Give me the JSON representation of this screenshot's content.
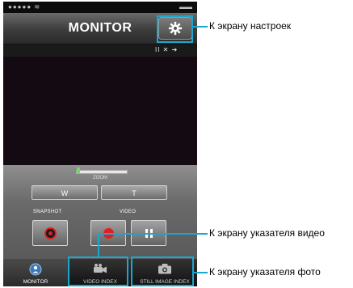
{
  "screen": {
    "title": "MONITOR",
    "statusbar": {
      "left": "●●●●●  ≋",
      "right": "▬▬"
    },
    "indicators": "II ✕ ➔",
    "zoom": {
      "label": "ZOOM",
      "level": 0.05,
      "wide_label": "W",
      "tele_label": "T"
    },
    "modes": {
      "snapshot_label": "SNAPSHOT",
      "video_label": "VIDEO"
    },
    "tabs": [
      {
        "label": "MONITOR",
        "icon": "monitor-icon",
        "active": true
      },
      {
        "label": "VIDEO INDEX",
        "icon": "video-camera-icon",
        "active": false
      },
      {
        "label": "STILL IMAGE INDEX",
        "icon": "camera-icon",
        "active": false
      }
    ]
  },
  "annotations": {
    "settings": "К экрану настроек",
    "video_index": "К экрану указателя видео",
    "photo_index": "К экрану указателя фото"
  },
  "colors": {
    "highlight": "#1aa7ce",
    "record": "#e02020",
    "zoom_indicator": "#7ad36f"
  }
}
